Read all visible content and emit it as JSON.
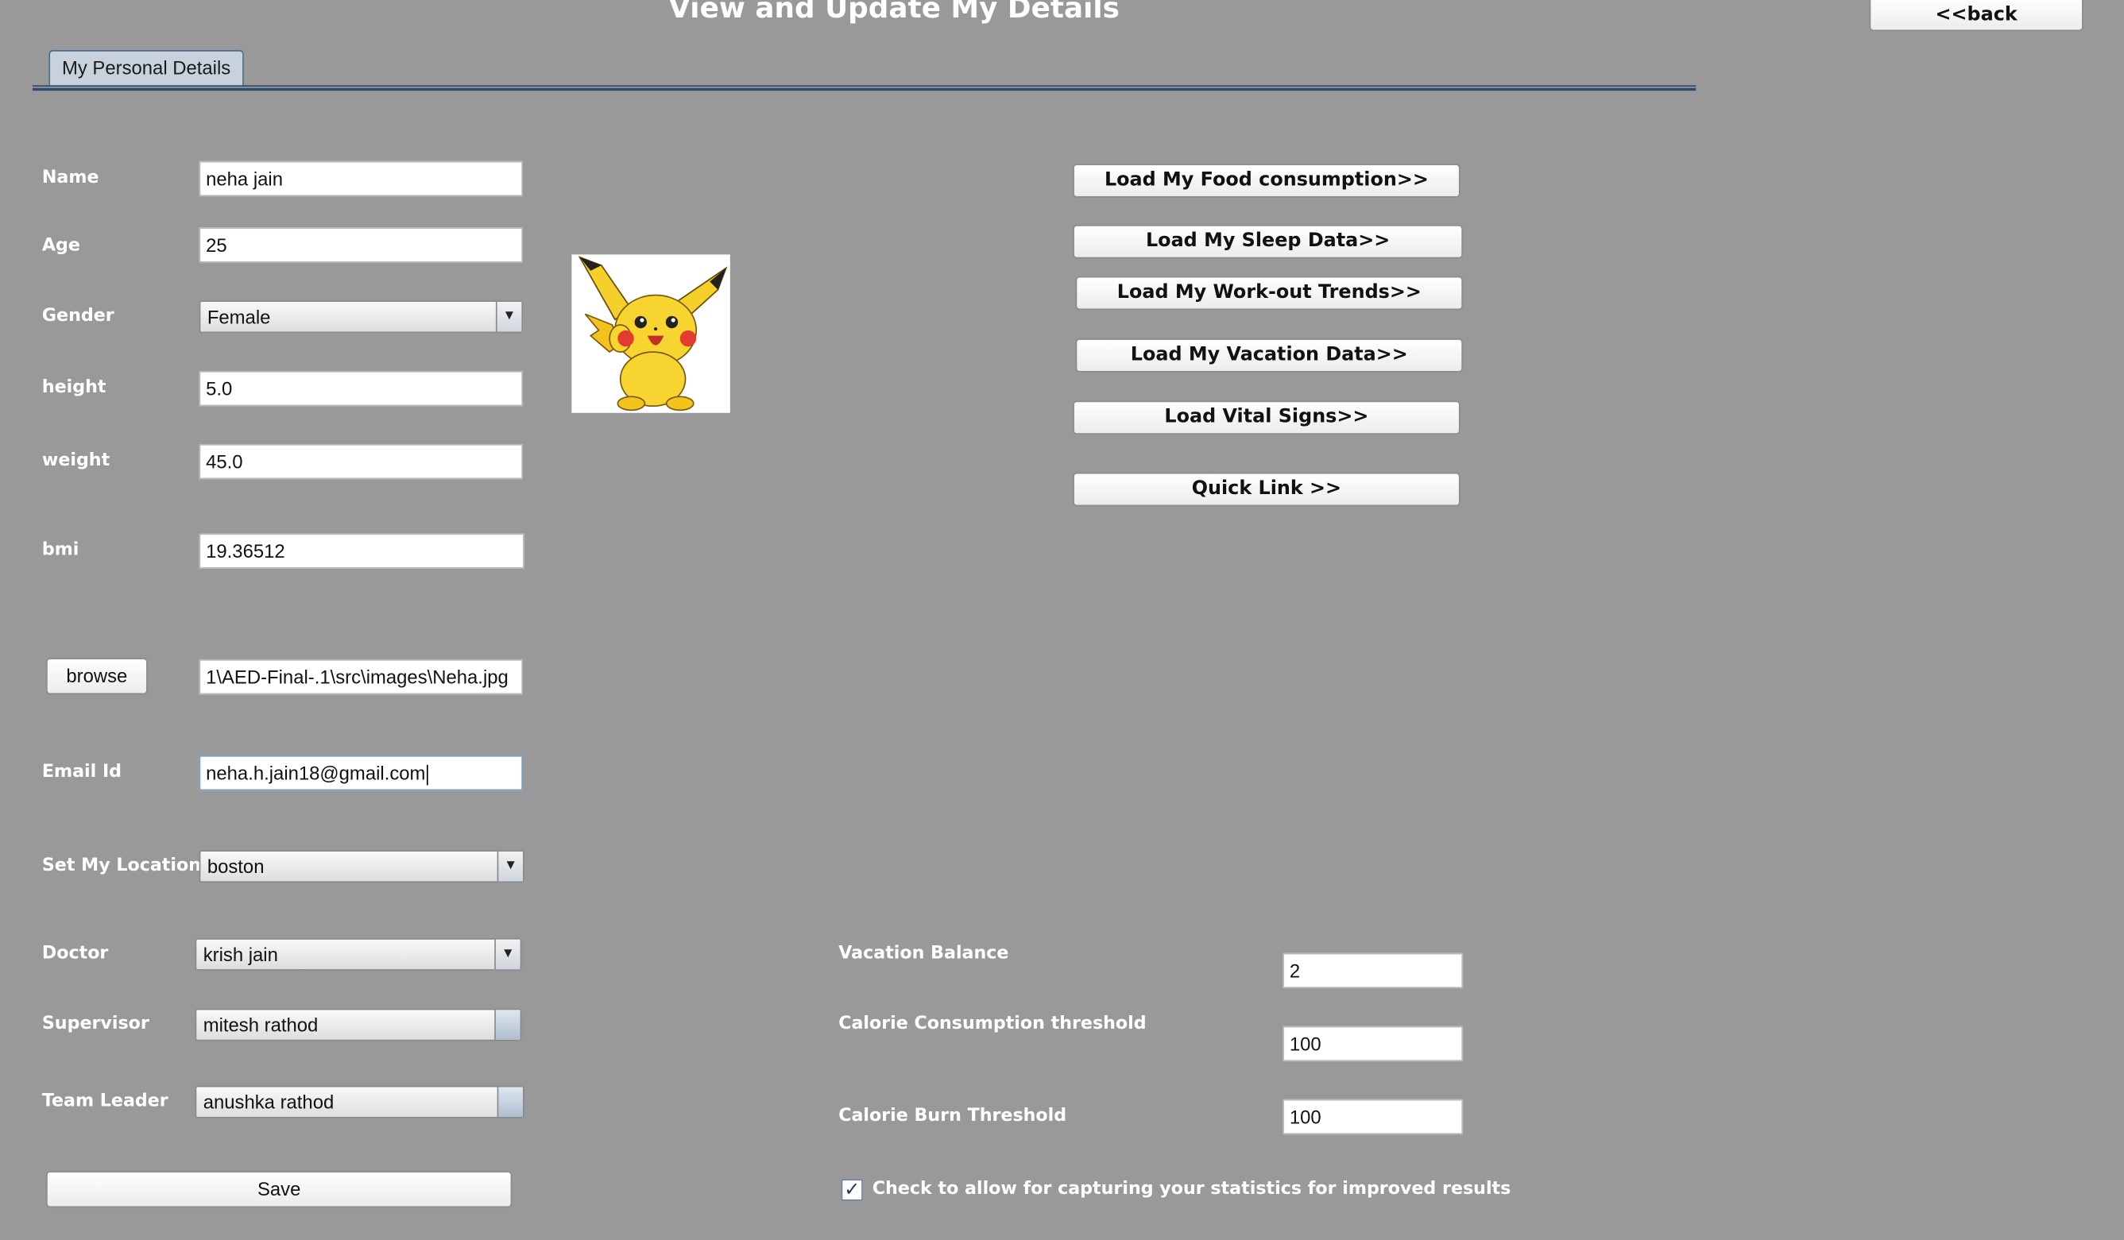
{
  "header": {
    "title": "View and Update My Details",
    "back_label": "<<back"
  },
  "tab": {
    "label": "My Personal Details"
  },
  "form": {
    "name": {
      "label": "Name",
      "value": "neha jain"
    },
    "age": {
      "label": "Age",
      "value": "25"
    },
    "gender": {
      "label": "Gender",
      "value": "Female"
    },
    "height": {
      "label": "height",
      "value": "5.0"
    },
    "weight": {
      "label": "weight",
      "value": "45.0"
    },
    "bmi": {
      "label": "bmi",
      "value": "19.36512"
    },
    "browse": {
      "label": "browse",
      "path": "1\\AED-Final-.1\\src\\images\\Neha.jpg"
    },
    "email": {
      "label": "Email Id",
      "value": "neha.h.jain18@gmail.com"
    },
    "location": {
      "label": "Set My Location",
      "value": "boston"
    },
    "doctor": {
      "label": "Doctor",
      "value": "krish jain"
    },
    "supervisor": {
      "label": "Supervisor",
      "value": "mitesh rathod"
    },
    "team_leader": {
      "label": "Team Leader",
      "value": "anushka rathod"
    },
    "save_label": "Save"
  },
  "actions": {
    "food": "Load My Food consumption>>",
    "sleep": "Load My Sleep Data>>",
    "workout": "Load My Work-out Trends>>",
    "vacation": "Load My Vacation Data>>",
    "vitals": "Load Vital Signs>>",
    "quick": "Quick Link >>"
  },
  "thresholds": {
    "vacation": {
      "label": "Vacation Balance",
      "value": "2"
    },
    "calorie_consumption": {
      "label": "Calorie Consumption threshold",
      "value": "100"
    },
    "calorie_burn": {
      "label": "Calorie Burn Threshold",
      "value": "100"
    }
  },
  "consent": {
    "label": "Check to allow for capturing your statistics for improved results",
    "checked": true
  },
  "icons": {
    "dropdown": "triangle-down-icon",
    "check": "checkmark-icon",
    "photo": "pikachu-avatar"
  }
}
